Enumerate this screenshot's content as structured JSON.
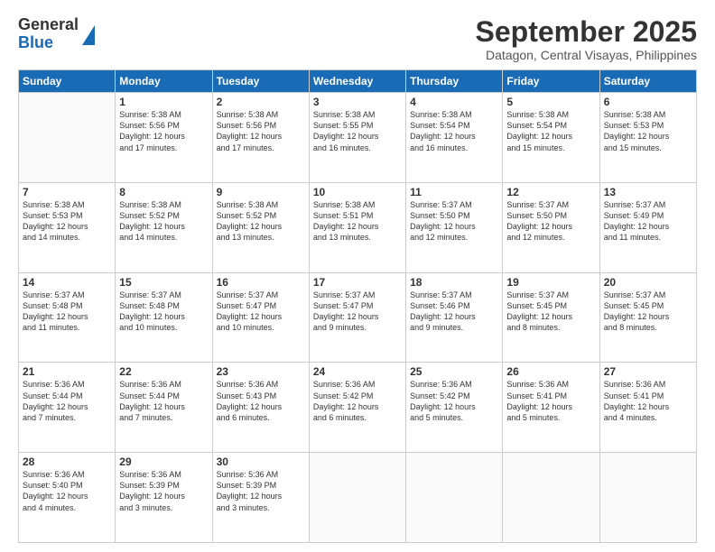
{
  "header": {
    "logo": {
      "line1": "General",
      "line2": "Blue"
    },
    "title": "September 2025",
    "subtitle": "Datagon, Central Visayas, Philippines"
  },
  "calendar": {
    "headers": [
      "Sunday",
      "Monday",
      "Tuesday",
      "Wednesday",
      "Thursday",
      "Friday",
      "Saturday"
    ],
    "weeks": [
      [
        {
          "day": "",
          "info": ""
        },
        {
          "day": "1",
          "info": "Sunrise: 5:38 AM\nSunset: 5:56 PM\nDaylight: 12 hours\nand 17 minutes."
        },
        {
          "day": "2",
          "info": "Sunrise: 5:38 AM\nSunset: 5:56 PM\nDaylight: 12 hours\nand 17 minutes."
        },
        {
          "day": "3",
          "info": "Sunrise: 5:38 AM\nSunset: 5:55 PM\nDaylight: 12 hours\nand 16 minutes."
        },
        {
          "day": "4",
          "info": "Sunrise: 5:38 AM\nSunset: 5:54 PM\nDaylight: 12 hours\nand 16 minutes."
        },
        {
          "day": "5",
          "info": "Sunrise: 5:38 AM\nSunset: 5:54 PM\nDaylight: 12 hours\nand 15 minutes."
        },
        {
          "day": "6",
          "info": "Sunrise: 5:38 AM\nSunset: 5:53 PM\nDaylight: 12 hours\nand 15 minutes."
        }
      ],
      [
        {
          "day": "7",
          "info": "Sunrise: 5:38 AM\nSunset: 5:53 PM\nDaylight: 12 hours\nand 14 minutes."
        },
        {
          "day": "8",
          "info": "Sunrise: 5:38 AM\nSunset: 5:52 PM\nDaylight: 12 hours\nand 14 minutes."
        },
        {
          "day": "9",
          "info": "Sunrise: 5:38 AM\nSunset: 5:52 PM\nDaylight: 12 hours\nand 13 minutes."
        },
        {
          "day": "10",
          "info": "Sunrise: 5:38 AM\nSunset: 5:51 PM\nDaylight: 12 hours\nand 13 minutes."
        },
        {
          "day": "11",
          "info": "Sunrise: 5:37 AM\nSunset: 5:50 PM\nDaylight: 12 hours\nand 12 minutes."
        },
        {
          "day": "12",
          "info": "Sunrise: 5:37 AM\nSunset: 5:50 PM\nDaylight: 12 hours\nand 12 minutes."
        },
        {
          "day": "13",
          "info": "Sunrise: 5:37 AM\nSunset: 5:49 PM\nDaylight: 12 hours\nand 11 minutes."
        }
      ],
      [
        {
          "day": "14",
          "info": "Sunrise: 5:37 AM\nSunset: 5:48 PM\nDaylight: 12 hours\nand 11 minutes."
        },
        {
          "day": "15",
          "info": "Sunrise: 5:37 AM\nSunset: 5:48 PM\nDaylight: 12 hours\nand 10 minutes."
        },
        {
          "day": "16",
          "info": "Sunrise: 5:37 AM\nSunset: 5:47 PM\nDaylight: 12 hours\nand 10 minutes."
        },
        {
          "day": "17",
          "info": "Sunrise: 5:37 AM\nSunset: 5:47 PM\nDaylight: 12 hours\nand 9 minutes."
        },
        {
          "day": "18",
          "info": "Sunrise: 5:37 AM\nSunset: 5:46 PM\nDaylight: 12 hours\nand 9 minutes."
        },
        {
          "day": "19",
          "info": "Sunrise: 5:37 AM\nSunset: 5:45 PM\nDaylight: 12 hours\nand 8 minutes."
        },
        {
          "day": "20",
          "info": "Sunrise: 5:37 AM\nSunset: 5:45 PM\nDaylight: 12 hours\nand 8 minutes."
        }
      ],
      [
        {
          "day": "21",
          "info": "Sunrise: 5:36 AM\nSunset: 5:44 PM\nDaylight: 12 hours\nand 7 minutes."
        },
        {
          "day": "22",
          "info": "Sunrise: 5:36 AM\nSunset: 5:44 PM\nDaylight: 12 hours\nand 7 minutes."
        },
        {
          "day": "23",
          "info": "Sunrise: 5:36 AM\nSunset: 5:43 PM\nDaylight: 12 hours\nand 6 minutes."
        },
        {
          "day": "24",
          "info": "Sunrise: 5:36 AM\nSunset: 5:42 PM\nDaylight: 12 hours\nand 6 minutes."
        },
        {
          "day": "25",
          "info": "Sunrise: 5:36 AM\nSunset: 5:42 PM\nDaylight: 12 hours\nand 5 minutes."
        },
        {
          "day": "26",
          "info": "Sunrise: 5:36 AM\nSunset: 5:41 PM\nDaylight: 12 hours\nand 5 minutes."
        },
        {
          "day": "27",
          "info": "Sunrise: 5:36 AM\nSunset: 5:41 PM\nDaylight: 12 hours\nand 4 minutes."
        }
      ],
      [
        {
          "day": "28",
          "info": "Sunrise: 5:36 AM\nSunset: 5:40 PM\nDaylight: 12 hours\nand 4 minutes."
        },
        {
          "day": "29",
          "info": "Sunrise: 5:36 AM\nSunset: 5:39 PM\nDaylight: 12 hours\nand 3 minutes."
        },
        {
          "day": "30",
          "info": "Sunrise: 5:36 AM\nSunset: 5:39 PM\nDaylight: 12 hours\nand 3 minutes."
        },
        {
          "day": "",
          "info": ""
        },
        {
          "day": "",
          "info": ""
        },
        {
          "day": "",
          "info": ""
        },
        {
          "day": "",
          "info": ""
        }
      ]
    ]
  }
}
